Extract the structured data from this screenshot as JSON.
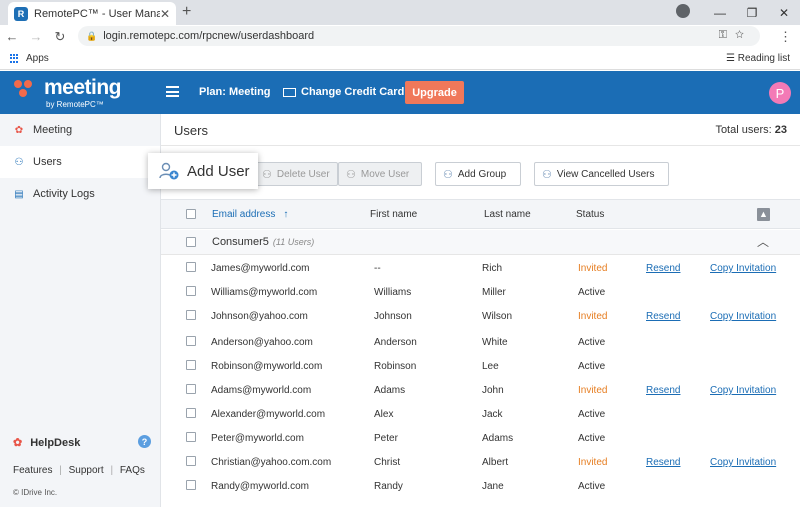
{
  "browser": {
    "tab_title": "RemotePC™ - User Management",
    "tab_favicon": "R",
    "tab_close": "✕",
    "new_tab": "+",
    "url": "login.remotepc.com/rpcnew/userdashboard",
    "bookmark_apps": "Apps",
    "reading_list": "Reading list"
  },
  "header": {
    "logo_word": "meeting",
    "logo_by": "by RemotePC™",
    "plan": "Plan: Meeting",
    "change_card": "Change Credit Card",
    "upgrade": "Upgrade",
    "avatar_letter": "P"
  },
  "sidebar": {
    "items": [
      {
        "label": "Meeting",
        "icon": "meeting-icon"
      },
      {
        "label": "Users",
        "icon": "users-icon"
      },
      {
        "label": "Activity Logs",
        "icon": "activity-logs-icon"
      }
    ],
    "helpdesk": "HelpDesk",
    "help_q": "?",
    "links": [
      "Features",
      "|",
      "Support",
      "|",
      "FAQs"
    ],
    "copyright": "© IDrive Inc."
  },
  "main": {
    "title": "Users",
    "total_label": "Total users:",
    "total_count": "23",
    "toolbar": {
      "add_user": "Add User",
      "delete_user": "Delete User",
      "move_user": "Move User",
      "add_group": "Add Group",
      "view_cancelled": "View Cancelled Users"
    },
    "columns": {
      "email": "Email address",
      "email_sort": "↑",
      "first": "First name",
      "last": "Last name",
      "status": "Status"
    },
    "group": {
      "name": "Consumer5",
      "count": "(11 Users)"
    },
    "rows": [
      {
        "email": "James@myworld.com",
        "first": "--",
        "last": "Rich",
        "status": "Invited",
        "resend": "Resend",
        "copy": "Copy Invitation"
      },
      {
        "email": "Williams@myworld.com",
        "first": "Williams",
        "last": "Miller",
        "status": "Active",
        "resend": "",
        "copy": ""
      },
      {
        "email": "Johnson@yahoo.com",
        "first": "Johnson",
        "last": "Wilson",
        "status": "Invited",
        "resend": "Resend",
        "copy": "Copy Invitation"
      },
      {
        "email": "Anderson@yahoo.com",
        "first": "Anderson",
        "last": "White",
        "status": "Active",
        "resend": "",
        "copy": ""
      },
      {
        "email": "Robinson@myworld.com",
        "first": "Robinson",
        "last": "Lee",
        "status": "Active",
        "resend": "",
        "copy": ""
      },
      {
        "email": "Adams@myworld.com",
        "first": "Adams",
        "last": "John",
        "status": "Invited",
        "resend": "Resend",
        "copy": "Copy Invitation"
      },
      {
        "email": "Alexander@myworld.com",
        "first": "Alex",
        "last": "Jack",
        "status": "Active",
        "resend": "",
        "copy": ""
      },
      {
        "email": "Peter@myworld.com",
        "first": "Peter",
        "last": "Adams",
        "status": "Active",
        "resend": "",
        "copy": ""
      },
      {
        "email": "Christian@yahoo.com.com",
        "first": "Christ",
        "last": "Albert",
        "status": "Invited",
        "resend": "Resend",
        "copy": "Copy Invitation"
      },
      {
        "email": "Randy@myworld.com",
        "first": "Randy",
        "last": "Jane",
        "status": "Active",
        "resend": "",
        "copy": ""
      }
    ]
  },
  "colors": {
    "header_blue": "#1b6db5",
    "upgrade_orange": "#f0785a",
    "invited_orange": "#e67e22",
    "link_blue": "#1b6db5",
    "avatar_pink": "#f37ab6"
  }
}
